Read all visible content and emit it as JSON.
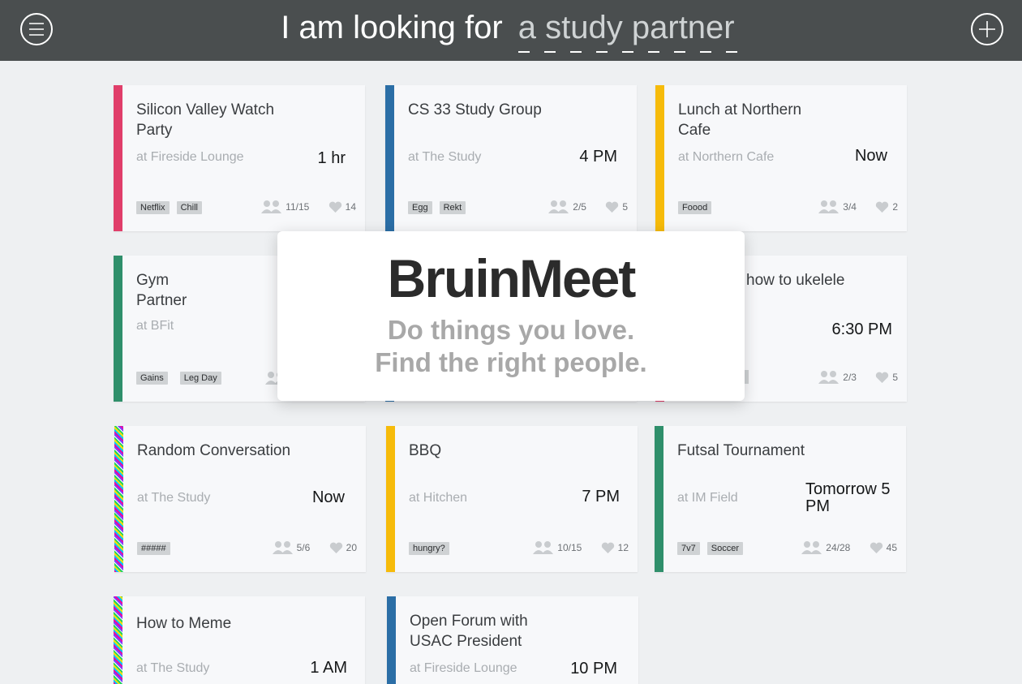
{
  "header": {
    "prefix": "I am looking for",
    "search_value": "a study partner",
    "background": "#4a4e4f"
  },
  "colors": {
    "red": "#e03e6a",
    "blue": "#2b6ea6",
    "yellow": "#f6bb0a",
    "green": "#2f8f6b"
  },
  "cards": [
    {
      "title": "Silicon Valley Watch Party",
      "location": "at Fireside Lounge",
      "time": "1 hr",
      "tags": [
        "Netflix",
        "Chill"
      ],
      "attendance": "11/15",
      "likes": "14"
    },
    {
      "title": "CS 33 Study Group",
      "location": "at The Study",
      "time": "4 PM",
      "tags": [
        "Egg",
        "Rekt"
      ],
      "attendance": "2/5",
      "likes": "5"
    },
    {
      "title": "Lunch at Northern Cafe",
      "location": "at Northern Cafe",
      "time": "Now",
      "tags": [
        "Foood"
      ],
      "attendance": "3/4",
      "likes": "2"
    },
    {
      "title": "Gym Partner",
      "location": "at BFit",
      "tags": [
        "Gains",
        "Leg Day"
      ]
    },
    {
      "title": "how to ukelele",
      "time": "6:30 PM",
      "attendance": "2/3",
      "likes": "5"
    },
    {
      "title": "Random Conversation",
      "location": "at The Study",
      "time": "Now",
      "tags": [
        "#####"
      ],
      "attendance": "5/6",
      "likes": "20"
    },
    {
      "title": "BBQ",
      "location": "at Hitchen",
      "time": "7 PM",
      "tags": [
        "hungry?"
      ],
      "attendance": "10/15",
      "likes": "12"
    },
    {
      "title": "Futsal Tournament",
      "location": "at IM Field",
      "time": "Tomorrow 5 PM",
      "tags": [
        "7v7",
        "Soccer"
      ],
      "attendance": "24/28",
      "likes": "45"
    },
    {
      "title": "How to Meme",
      "location": "at The Study",
      "time": "1 AM"
    },
    {
      "title": "Open Forum with USAC President",
      "location": "at Fireside Lounge",
      "time": "10 PM"
    }
  ],
  "splash": {
    "brand": "BruinMeet",
    "line1": "Do things you love.",
    "line2": "Find the right people."
  }
}
